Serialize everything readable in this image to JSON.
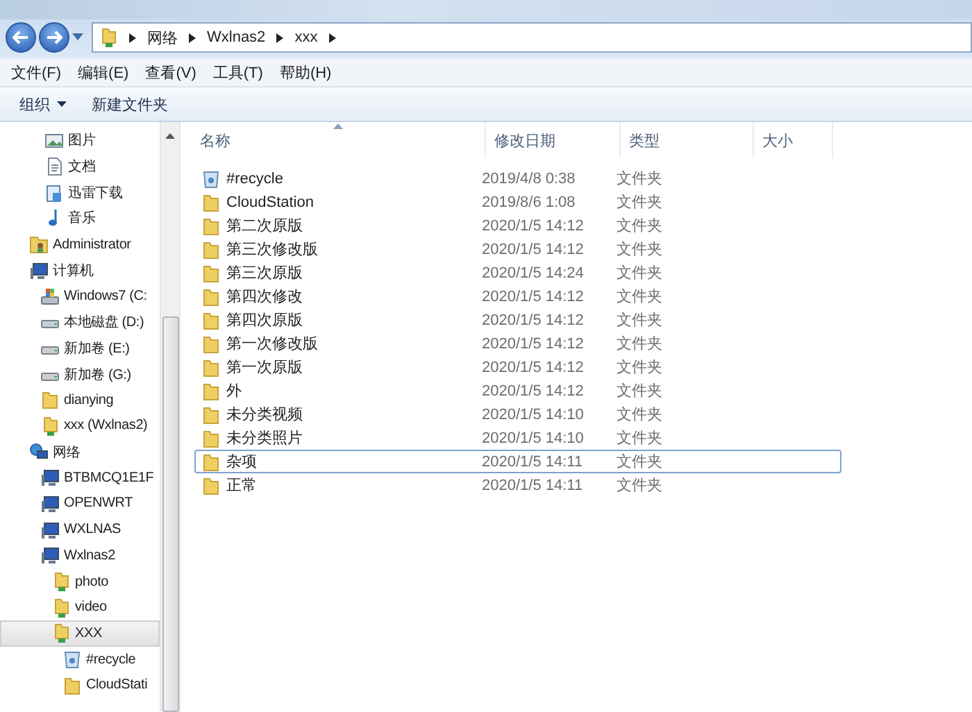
{
  "address_bar": {
    "crumbs": [
      "网络",
      "Wxlnas2",
      "xxx"
    ]
  },
  "menu_bar": [
    "文件(F)",
    "编辑(E)",
    "查看(V)",
    "工具(T)",
    "帮助(H)"
  ],
  "toolbar": {
    "organize": "组织",
    "new_folder": "新建文件夹"
  },
  "nav_pane": {
    "library_items": [
      {
        "label": "图片",
        "kind": "pictures",
        "selected": false
      },
      {
        "label": "文档",
        "kind": "documents",
        "selected": false
      },
      {
        "label": "迅雷下载",
        "kind": "download",
        "selected": false
      },
      {
        "label": "音乐",
        "kind": "music",
        "selected": false
      }
    ],
    "tree": [
      {
        "label": "Administrator",
        "kind": "user",
        "selected": false
      },
      {
        "label": "计算机",
        "kind": "computer",
        "selected": false,
        "children": [
          {
            "label": "Windows7 (C:",
            "kind": "osdrive",
            "selected": false
          },
          {
            "label": "本地磁盘 (D:)",
            "kind": "drive",
            "selected": false
          },
          {
            "label": "新加卷 (E:)",
            "kind": "drive",
            "selected": false
          },
          {
            "label": "新加卷 (G:)",
            "kind": "drive",
            "selected": false
          },
          {
            "label": "dianying",
            "kind": "folder",
            "selected": false
          },
          {
            "label": "xxx (Wxlnas2)",
            "kind": "share",
            "selected": false
          }
        ]
      },
      {
        "label": "网络",
        "kind": "network",
        "selected": false,
        "children": [
          {
            "label": "BTBMCQ1E1F",
            "kind": "pc",
            "selected": false
          },
          {
            "label": "OPENWRT",
            "kind": "pc",
            "selected": false
          },
          {
            "label": "WXLNAS",
            "kind": "pc",
            "selected": false
          },
          {
            "label": "Wxlnas2",
            "kind": "pc",
            "selected": false,
            "children": [
              {
                "label": "photo",
                "kind": "share",
                "selected": false
              },
              {
                "label": "video",
                "kind": "share",
                "selected": false
              },
              {
                "label": "XXX",
                "kind": "share",
                "selected": true,
                "children": [
                  {
                    "label": "#recycle",
                    "kind": "recycle",
                    "selected": false
                  },
                  {
                    "label": "CloudStati",
                    "kind": "folder",
                    "selected": false
                  }
                ]
              }
            ]
          }
        ]
      }
    ]
  },
  "file_list": {
    "columns": [
      "名称",
      "修改日期",
      "类型",
      "大小"
    ],
    "rows": [
      {
        "name": "#recycle",
        "kind": "recycle",
        "date": "2019/4/8 0:38",
        "type": "文件夹",
        "selected": false
      },
      {
        "name": "CloudStation",
        "kind": "folder",
        "date": "2019/8/6 1:08",
        "type": "文件夹",
        "selected": false
      },
      {
        "name": "第二次原版",
        "kind": "folder",
        "date": "2020/1/5 14:12",
        "type": "文件夹",
        "selected": false
      },
      {
        "name": "第三次修改版",
        "kind": "folder",
        "date": "2020/1/5 14:12",
        "type": "文件夹",
        "selected": false
      },
      {
        "name": "第三次原版",
        "kind": "folder",
        "date": "2020/1/5 14:24",
        "type": "文件夹",
        "selected": false
      },
      {
        "name": "第四次修改",
        "kind": "folder",
        "date": "2020/1/5 14:12",
        "type": "文件夹",
        "selected": false
      },
      {
        "name": "第四次原版",
        "kind": "folder",
        "date": "2020/1/5 14:12",
        "type": "文件夹",
        "selected": false
      },
      {
        "name": "第一次修改版",
        "kind": "folder",
        "date": "2020/1/5 14:12",
        "type": "文件夹",
        "selected": false
      },
      {
        "name": "第一次原版",
        "kind": "folder",
        "date": "2020/1/5 14:12",
        "type": "文件夹",
        "selected": false
      },
      {
        "name": "外",
        "kind": "folder",
        "date": "2020/1/5 14:12",
        "type": "文件夹",
        "selected": false
      },
      {
        "name": "未分类视频",
        "kind": "folder",
        "date": "2020/1/5 14:10",
        "type": "文件夹",
        "selected": false
      },
      {
        "name": "未分类照片",
        "kind": "folder",
        "date": "2020/1/5 14:10",
        "type": "文件夹",
        "selected": false
      },
      {
        "name": "杂项",
        "kind": "folder",
        "date": "2020/1/5 14:11",
        "type": "文件夹",
        "selected": true
      },
      {
        "name": "正常",
        "kind": "folder",
        "date": "2020/1/5 14:11",
        "type": "文件夹",
        "selected": false
      }
    ]
  }
}
